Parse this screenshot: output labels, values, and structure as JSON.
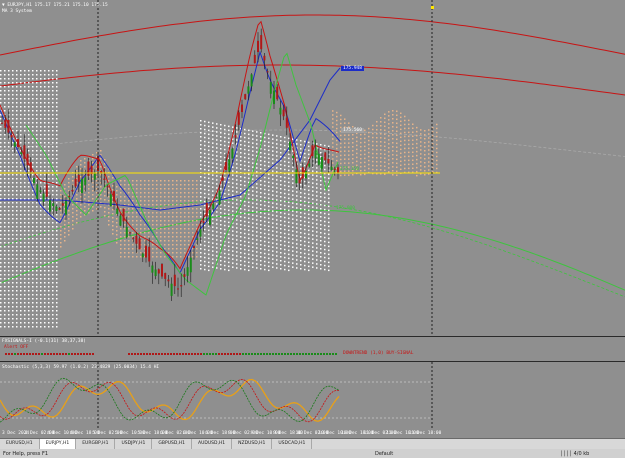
{
  "main": {
    "symbol_header": "▼ EURJPY,H1 175.17 175.21 175.10 175.15",
    "indicator_name": "MA 3 System",
    "price_tag_top": "175.948",
    "price_tag_mid": "175.560",
    "price_tag_pivot": "175.150",
    "price_tag_low": "175.000"
  },
  "ind1": {
    "header": "FXSIGNALS-I (-0.1(31) 38,37,38)",
    "sub": "Alert OFF",
    "status_text": "DOWNTREND (1,0)  BUY-SIGNAL"
  },
  "ind2": {
    "header": "Stochastic (5,3,3) 59.97 (1.0.2) 23.4829 (25.0034) 15.4 HI"
  },
  "timeaxis": {
    "labels": [
      "3 Dec 2024",
      "4 Dec 02:00",
      "4 Dec 10:00",
      "4 Dec 18:00",
      "5 Dec 02:00",
      "5 Dec 10:00",
      "5 Dec 18:00",
      "6 Dec 02:00",
      "6 Dec 10:00",
      "6 Dec 18:00",
      "9 Dec 02:00",
      "9 Dec 10:00",
      "9 Dec 18:00",
      "10 Dec 02:00",
      "10 Dec 10:00",
      "10 Dec 18:00",
      "11 Dec 02:00",
      "11 Dec 10:00",
      "11 Dec 18:00"
    ]
  },
  "tabs": [
    "EURUSD,H1",
    "EURJPY,H1",
    "EURGBP,H1",
    "USDJPY,H1",
    "GBPUSD,H1",
    "AUDUSD,H1",
    "NZDUSD,H1",
    "USDCAD,H1"
  ],
  "status": {
    "left": "For Help, press F1",
    "mid": "Default",
    "right": "││││ 4/0 kb"
  },
  "colors": {
    "background": "#8f8f8f",
    "bull_candle": "#1a8c1a",
    "bear_candle": "#b01818",
    "yellow_line": "#ffe600",
    "blue_line": "#1c2cc8",
    "red_band": "#c81414",
    "green_band": "#3ec43e",
    "cloud_bull": "#e8b48a",
    "cloud_bear": "#ffffff"
  }
}
